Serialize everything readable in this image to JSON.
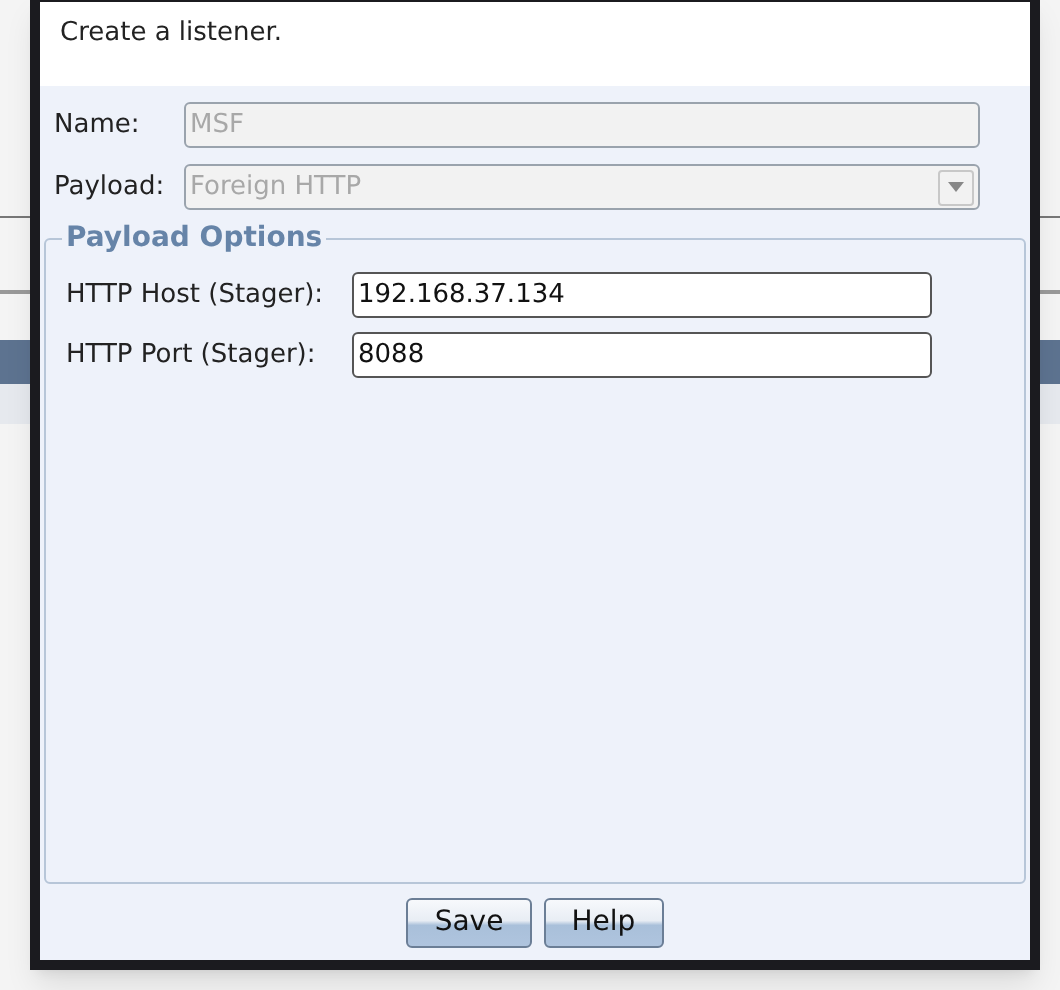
{
  "dialog": {
    "description": "Create a listener.",
    "fields": [
      {
        "label": "Name:",
        "value": "MSF",
        "kind": "text",
        "disabled": true
      },
      {
        "label": "Payload:",
        "value": "Foreign HTTP",
        "kind": "dropdown",
        "disabled": true
      }
    ],
    "payload_options": {
      "title": "Payload Options",
      "fields": [
        {
          "label": "HTTP Host (Stager):",
          "value": "192.168.37.134",
          "disabled": false
        },
        {
          "label": "HTTP Port (Stager):",
          "value": "8088",
          "disabled": false
        }
      ]
    },
    "buttons": [
      "Save",
      "Help"
    ]
  }
}
